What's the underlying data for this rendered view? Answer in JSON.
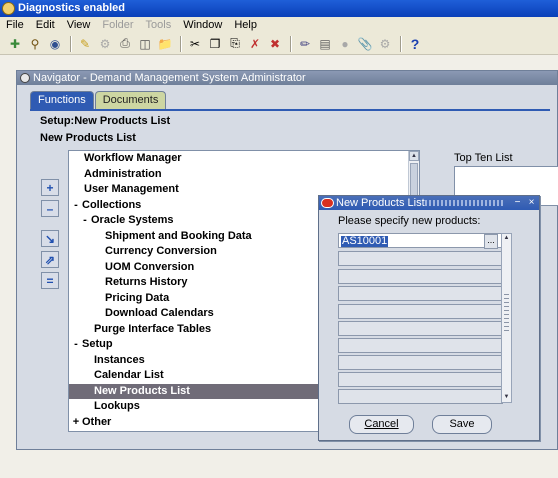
{
  "titlebar": {
    "title": "Diagnostics enabled"
  },
  "menu": [
    {
      "label": "File",
      "disabled": false
    },
    {
      "label": "Edit",
      "disabled": false
    },
    {
      "label": "View",
      "disabled": false
    },
    {
      "label": "Folder",
      "disabled": true
    },
    {
      "label": "Tools",
      "disabled": true
    },
    {
      "label": "Window",
      "disabled": false
    },
    {
      "label": "Help",
      "disabled": false
    }
  ],
  "navigator": {
    "title": "Navigator - Demand Management System Administrator",
    "tabs": {
      "functions": "Functions",
      "documents": "Documents"
    },
    "heading1": "Setup:New Products List",
    "heading2": "New Products List",
    "top_ten_label": "Top Ten List",
    "tree": [
      {
        "label": "Workflow Manager",
        "prefix": ""
      },
      {
        "label": "Administration",
        "prefix": ""
      },
      {
        "label": "User Management",
        "prefix": ""
      },
      {
        "label": "Collections",
        "prefix": "-"
      },
      {
        "label": "Oracle Systems",
        "prefix": "-"
      },
      {
        "label": "Shipment and Booking Data",
        "prefix": ""
      },
      {
        "label": "Currency Conversion",
        "prefix": ""
      },
      {
        "label": "UOM Conversion",
        "prefix": ""
      },
      {
        "label": "Returns History",
        "prefix": ""
      },
      {
        "label": "Pricing Data",
        "prefix": ""
      },
      {
        "label": "Download Calendars",
        "prefix": ""
      },
      {
        "label": "Purge Interface Tables",
        "prefix": ""
      },
      {
        "label": "Setup",
        "prefix": "-"
      },
      {
        "label": "Instances",
        "prefix": ""
      },
      {
        "label": "Calendar List",
        "prefix": ""
      },
      {
        "label": "New Products List",
        "prefix": "",
        "selected": true
      },
      {
        "label": "Lookups",
        "prefix": ""
      },
      {
        "label": "Other",
        "prefix": "+"
      }
    ]
  },
  "dialog": {
    "title": "New Products List",
    "prompt": "Please specify new products:",
    "first_value": "AS10001",
    "lov_label": "...",
    "cancel_label": "Cancel",
    "save_label": "Save"
  }
}
